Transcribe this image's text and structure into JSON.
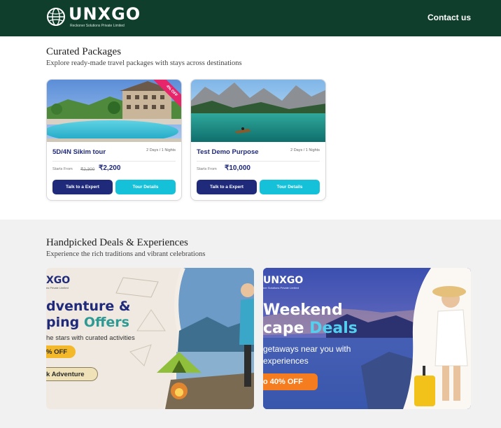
{
  "header": {
    "logo_text": "UNXGO",
    "logo_sub": "Reckoner Solutions Private Limited",
    "contact_label": "Contact us"
  },
  "curated": {
    "title": "Curated Packages",
    "subtitle": "Explore ready-made travel packages with stays across destinations",
    "cards": [
      {
        "title": "5D/4N Sikim tour",
        "duration": "2 Days / 1 Nights",
        "starts_from": "Starts From",
        "old_price": "₹2,300",
        "price": "₹2,200",
        "badge": "4% OFF",
        "talk_label": "Talk to a Expert",
        "tour_label": "Tour Details"
      },
      {
        "title": "Test Demo Purpose",
        "duration": "2 Days / 1 Nights",
        "starts_from": "Starts From",
        "price": "₹10,000",
        "talk_label": "Talk to a Expert",
        "tour_label": "Tour Details"
      }
    ]
  },
  "deals": {
    "title": "Handpicked Deals & Experiences",
    "subtitle": "Experience the rich traditions and vibrant celebrations",
    "banners": [
      {
        "logo": "XGO",
        "logo_sub": "ns Private Limited",
        "head1": "dventure &",
        "head2_a": "ping ",
        "head2_b": "Offers",
        "line1": "he stars with curated activities",
        "pill1": "% OFF",
        "pill2": "k Adventure",
        "accent_color": "#2e9a93"
      },
      {
        "logo": "UNXGO",
        "logo_sub": "ner Solutions Private Limited",
        "head1": "Weekend",
        "head2_a": "cape ",
        "head2_b": "Deals",
        "line1": "getaways near you with",
        "line2": "experiences",
        "pill1": "o 40% OFF",
        "accent_color": "#53d0f0"
      }
    ]
  },
  "colors": {
    "header_bg": "#0f3f2c",
    "navy": "#1f2a7a",
    "cyan": "#14c1d8",
    "badge_pink": "#e6256b",
    "orange": "#f57c1f"
  }
}
